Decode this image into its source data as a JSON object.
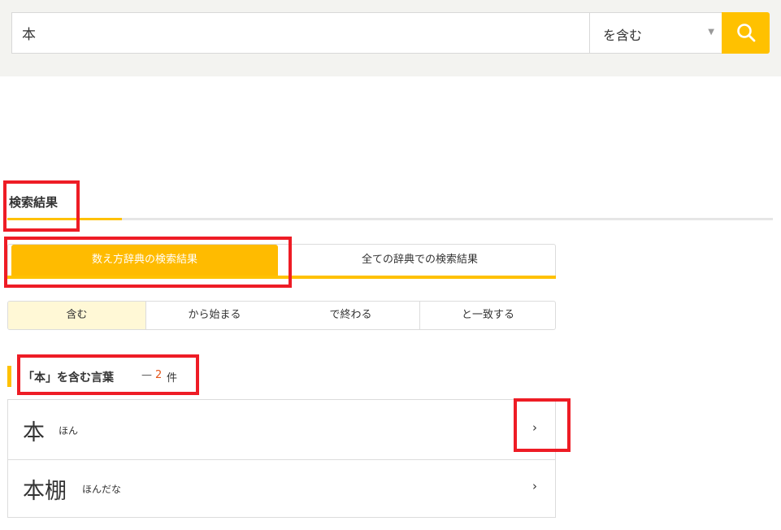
{
  "search": {
    "query": "本",
    "mode_label": "を含む",
    "mode_caret": "▼"
  },
  "results": {
    "heading": "検索結果",
    "dict_tabs": {
      "active_label": "数え方辞典の検索結果",
      "other_label": "全ての辞典での検索結果"
    },
    "match_tabs": [
      {
        "label": "含む"
      },
      {
        "label": "から始まる"
      },
      {
        "label": "で終わる"
      },
      {
        "label": "と一致する"
      }
    ],
    "count": {
      "title": "「本」を含む言葉",
      "dash": "—",
      "number": "2",
      "unit": "件"
    },
    "items": [
      {
        "word": "本",
        "reading": "ほん",
        "chevron": "›"
      },
      {
        "word": "本棚",
        "reading": "ほんだな",
        "chevron": "›"
      }
    ]
  },
  "colors": {
    "accent": "#ffc100",
    "active_tab_bg": "#ffbb00",
    "active_match_bg": "#fff8d6",
    "count_number": "#e5571b",
    "annotation_box": "#ee1c25"
  }
}
